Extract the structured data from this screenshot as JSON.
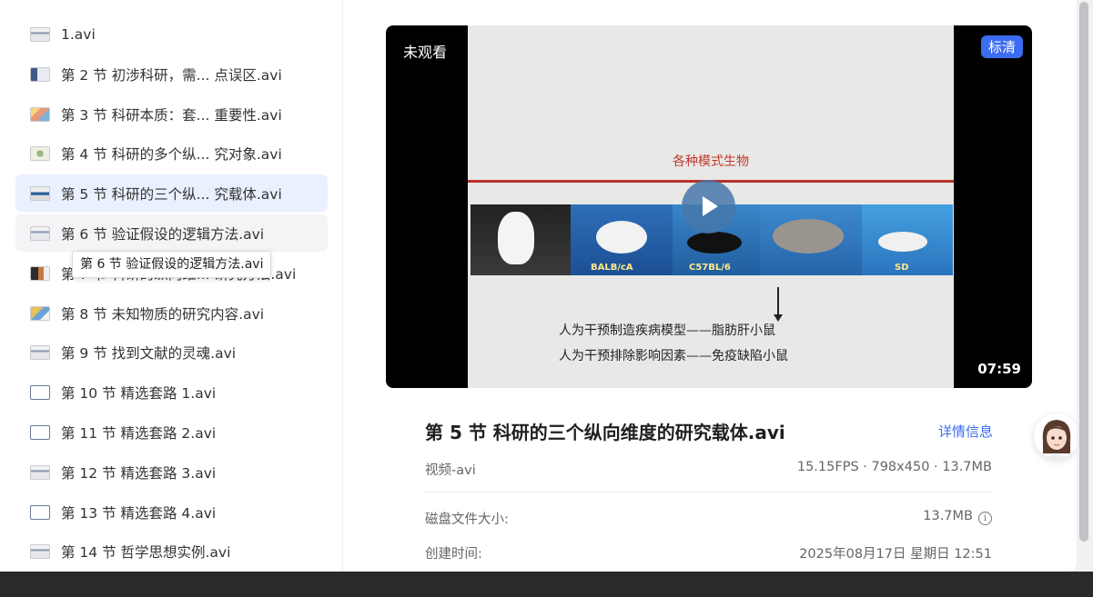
{
  "sidebar": {
    "items": [
      {
        "label": "1.avi",
        "thumb": "t1"
      },
      {
        "label": "第 2 节 初涉科研，需...  点误区.avi",
        "thumb": "t2"
      },
      {
        "label": "第 3 节 科研本质：套...  重要性.avi",
        "thumb": "t3"
      },
      {
        "label": "第 4 节 科研的多个纵...  究对象.avi",
        "thumb": "t4"
      },
      {
        "label": "第 5 节 科研的三个纵...  究载体.avi",
        "thumb": "t5",
        "state": "active"
      },
      {
        "label": "第 6 节 验证假设的逻辑方法.avi",
        "thumb": "t1",
        "state": "hover"
      },
      {
        "label": "第 7 节 科研的纵向维...  研究方法.avi",
        "thumb": "t7"
      },
      {
        "label": "第 8 节 未知物质的研究内容.avi",
        "thumb": "t8"
      },
      {
        "label": "第 9 节 找到文献的灵魂.avi",
        "thumb": "t1"
      },
      {
        "label": "第 10 节 精选套路 1.avi",
        "thumb": "t10"
      },
      {
        "label": "第 11 节 精选套路 2.avi",
        "thumb": "t10"
      },
      {
        "label": "第 12 节 精选套路 3.avi",
        "thumb": "t1"
      },
      {
        "label": "第 13 节 精选套路 4.avi",
        "thumb": "t10"
      },
      {
        "label": "第 14 节 哲学思想实例.avi",
        "thumb": "t1"
      }
    ],
    "tooltip": "第 6 节 验证假设的逻辑方法.avi"
  },
  "video": {
    "status": "未观看",
    "quality": "标清",
    "duration": "07:59",
    "slide": {
      "heading": "各种模式生物",
      "labels": [
        "BALB/cA",
        "C57BL/6",
        "SD"
      ],
      "line1": "人为干预制造疾病模型——脂肪肝小鼠",
      "line2": "人为干预排除影响因素——免疫缺陷小鼠"
    }
  },
  "info": {
    "title": "第 5 节 科研的三个纵向维度的研究载体.avi",
    "details_link": "详情信息",
    "type": "视频-avi",
    "meta": "15.15FPS · 798x450 · 13.7MB",
    "disk_size_label": "磁盘文件大小:",
    "disk_size_value": "13.7MB",
    "created_label": "创建时间:",
    "created_value": "2025年08月17日 星期日 12:51"
  },
  "colors": {
    "accent": "#3c6cf0",
    "active_bg": "#e9f0fe"
  }
}
